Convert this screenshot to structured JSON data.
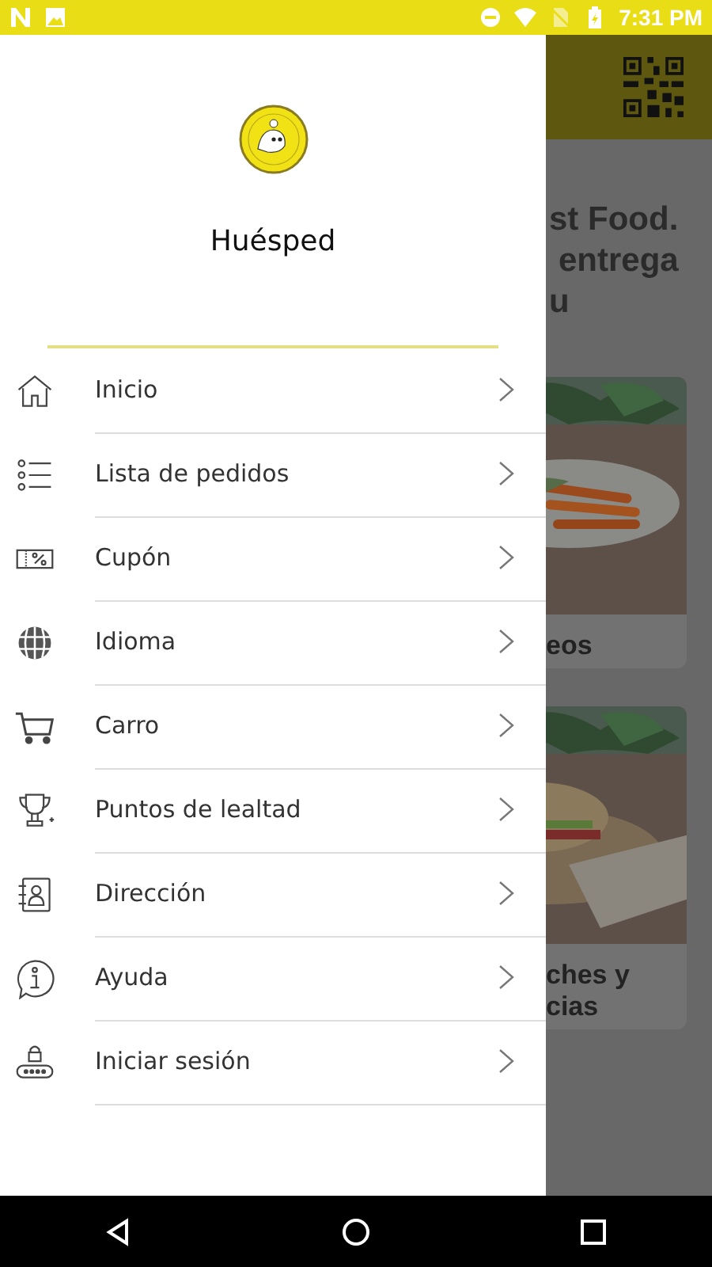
{
  "status_bar": {
    "time": "7:31 PM"
  },
  "drawer": {
    "user_name": "Huésped",
    "menu": [
      {
        "kind": "home",
        "label": "Inicio"
      },
      {
        "kind": "list",
        "label": "Lista de pedidos"
      },
      {
        "kind": "coupon",
        "label": "Cupón"
      },
      {
        "kind": "globe",
        "label": "Idioma"
      },
      {
        "kind": "cart",
        "label": "Carro"
      },
      {
        "kind": "trophy",
        "label": "Puntos de lealtad"
      },
      {
        "kind": "contacts",
        "label": "Dirección"
      },
      {
        "kind": "info",
        "label": "Ayuda"
      },
      {
        "kind": "login",
        "label": "Iniciar sesión"
      }
    ]
  },
  "background": {
    "hero_lines": [
      "st Food.",
      "entrega",
      "u"
    ],
    "cards": [
      {
        "kind": "picture",
        "title_lines": [
          "eos"
        ]
      },
      {
        "kind": "picture",
        "title_lines": [
          "ches y",
          "cias"
        ]
      }
    ]
  }
}
